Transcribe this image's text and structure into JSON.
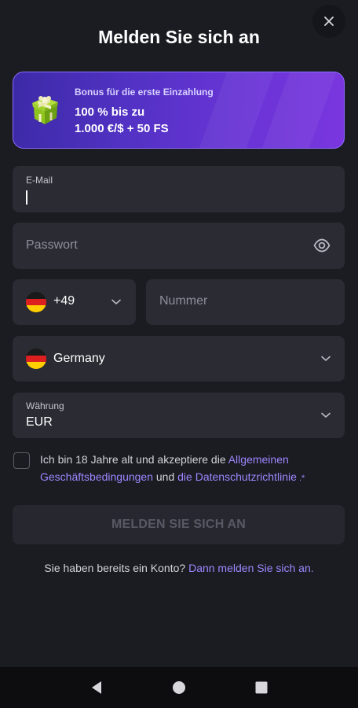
{
  "header": {
    "title": "Melden Sie sich an",
    "close_icon": "close-icon"
  },
  "bonus": {
    "subtitle": "Bonus für die erste Einzahlung",
    "line1": "100 % bis zu",
    "line2": "1.000 €/$ + 50 FS",
    "icon": "gift-icon"
  },
  "email": {
    "label": "E-Mail",
    "value": ""
  },
  "password": {
    "placeholder": "Passwort",
    "icon": "eye-icon"
  },
  "phone": {
    "country_code": "+49",
    "placeholder": "Nummer",
    "flag": "germany-flag-icon"
  },
  "country": {
    "value": "Germany",
    "flag": "germany-flag-icon"
  },
  "currency": {
    "label": "Währung",
    "value": "EUR"
  },
  "terms": {
    "text_before": "Ich bin 18 Jahre alt und akzeptiere die ",
    "link_terms": "Allgemeinen Geschäftsbedingungen",
    "text_and": " und ",
    "link_privacy": "die Datenschutzrichtlinie",
    "suffix": " .*",
    "checked": false
  },
  "submit": {
    "label": "MELDEN SIE SICH AN"
  },
  "login": {
    "text": "Sie haben bereits ein Konto? ",
    "link": "Dann melden Sie sich an."
  },
  "colors": {
    "background": "#1b1c22",
    "field": "#2a2b33",
    "accent_link": "#9d86ff",
    "bonus_gradient_start": "#3c2aa7",
    "bonus_gradient_end": "#7a36df"
  },
  "android_nav": {
    "back_icon": "back-triangle-icon",
    "home_icon": "home-circle-icon",
    "recents_icon": "recents-square-icon"
  }
}
